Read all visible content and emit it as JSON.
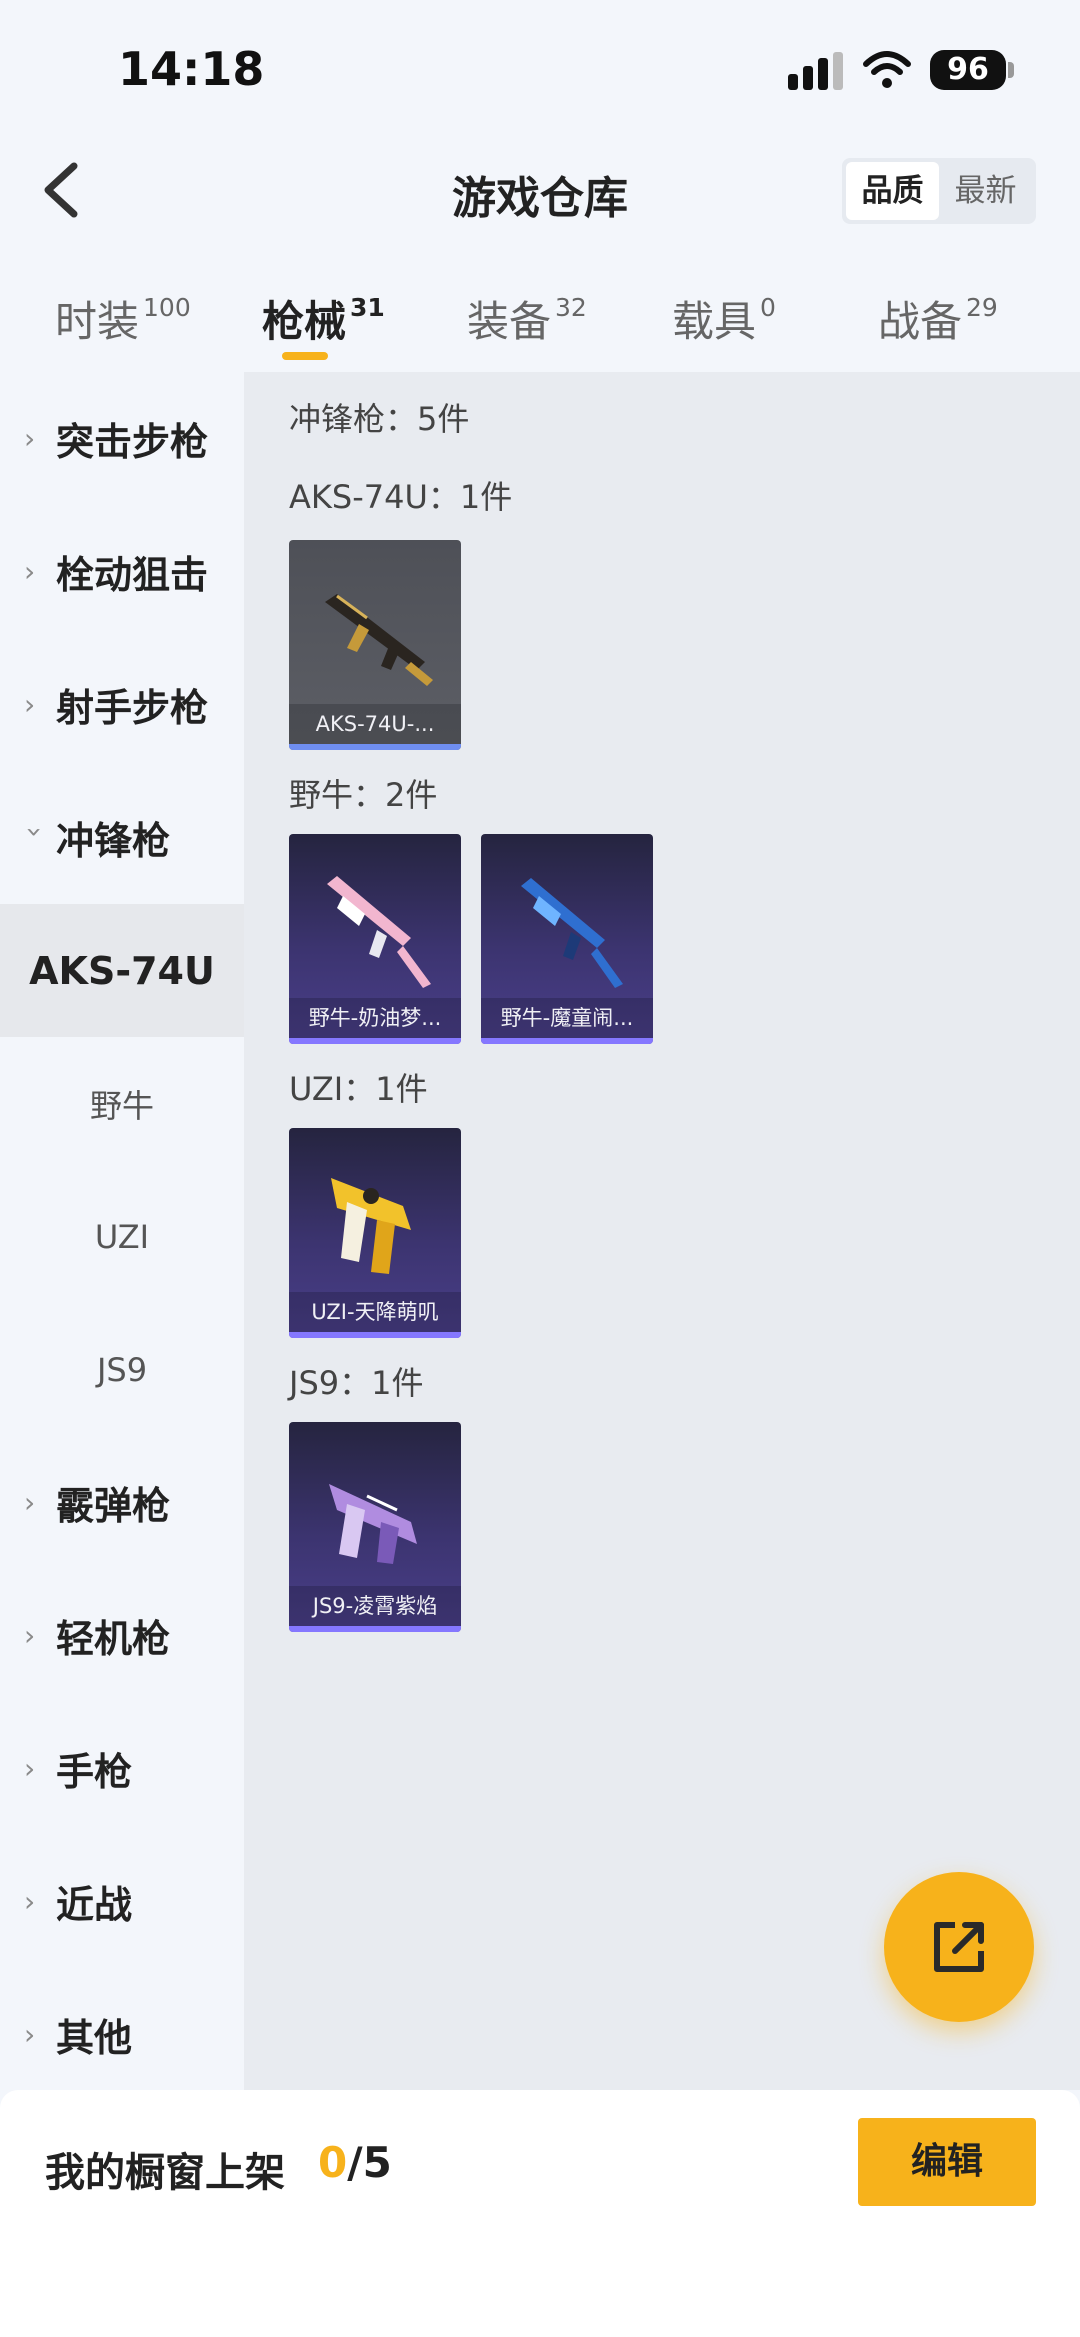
{
  "status_bar": {
    "time": "14:18",
    "battery": "96"
  },
  "header": {
    "title": "游戏仓库",
    "sort_options": [
      "品质",
      "最新"
    ]
  },
  "tabs": [
    {
      "label": "时装",
      "count": "100"
    },
    {
      "label": "枪械",
      "count": "31"
    },
    {
      "label": "装备",
      "count": "32"
    },
    {
      "label": "载具",
      "count": "0"
    },
    {
      "label": "战备",
      "count": "29"
    }
  ],
  "sidebar": {
    "items": [
      {
        "label": "突击步枪"
      },
      {
        "label": "栓动狙击"
      },
      {
        "label": "射手步枪"
      },
      {
        "label": "冲锋枪"
      },
      {
        "label": "AKS-74U"
      },
      {
        "label": "野牛"
      },
      {
        "label": "UZI"
      },
      {
        "label": "JS9"
      },
      {
        "label": "霰弹枪"
      },
      {
        "label": "轻机枪"
      },
      {
        "label": "手枪"
      },
      {
        "label": "近战"
      },
      {
        "label": "其他"
      }
    ]
  },
  "content": {
    "category_summary": "冲锋枪：5件",
    "groups": [
      {
        "label": "AKS-74U：1件",
        "items": [
          "AKS-74U-..."
        ]
      },
      {
        "label": "野牛：2件",
        "items": [
          "野牛-奶油梦...",
          "野牛-魔童闹..."
        ]
      },
      {
        "label": "UZI：1件",
        "items": [
          "UZI-天降萌叽"
        ]
      },
      {
        "label": "JS9：1件",
        "items": [
          "JS9-凌霄紫焰"
        ]
      }
    ]
  },
  "bottom_bar": {
    "shelf_label": "我的橱窗上架",
    "shelf_current": "0",
    "shelf_total": "/5",
    "edit_label": "编辑"
  },
  "colors": {
    "accent": "#f7b21b",
    "card_bar": "#8577ff"
  }
}
